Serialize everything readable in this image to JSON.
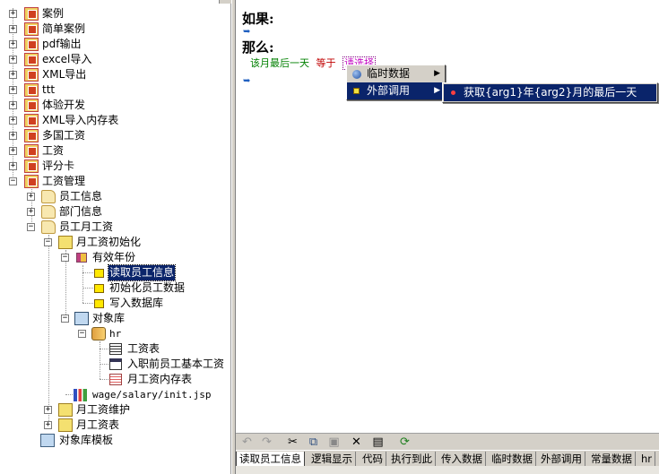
{
  "tree": {
    "top_items": [
      "案例",
      "简单案例",
      "pdf输出",
      "excel导入",
      "XML导出",
      "ttt",
      "体验开发",
      "XML导入内存表",
      "多国工资",
      "工资",
      "评分卡",
      "工资管理"
    ],
    "gz_children": [
      "员工信息",
      "部门信息",
      "员工月工资"
    ],
    "init_folder": "月工资初始化",
    "year_node": "有效年份",
    "rules": [
      "读取员工信息",
      "初始化员工数据",
      "写入数据库"
    ],
    "lib_node": "对象库",
    "db_node": "hr",
    "tables": [
      "工资表",
      "入职前员工基本工资",
      "月工资内存表"
    ],
    "jsp_node": "wage/salary/init.jsp",
    "maint_node": "月工资维护",
    "salary_table_node": "月工资表",
    "template_node": "对象库模板"
  },
  "editor": {
    "if_label": "如果:",
    "then_label": "那么:",
    "rule_part1": "该月最后一天",
    "rule_part2": "等于",
    "rule_placeholder": "请选择",
    "rule_tail": "..."
  },
  "menu": {
    "items": [
      "临时数据",
      "外部调用"
    ],
    "submenu_items": [
      "获取{arg1}年{arg2}月的最后一天"
    ]
  },
  "toolbar": {
    "icons": [
      "undo-icon",
      "redo-icon",
      "cut-icon",
      "copy-icon",
      "paste-icon",
      "delete-icon",
      "preview-icon",
      "refresh-icon"
    ]
  },
  "tabs": [
    "读取员工信息",
    "逻辑显示",
    "代码",
    "执行到此",
    "传入数据",
    "临时数据",
    "外部调用",
    "常量数据",
    "hr"
  ],
  "colors": {
    "selection": "#0a246a",
    "window_bg": "#d4d0c8",
    "rule_green": "#008000",
    "rule_red": "#c00000"
  }
}
